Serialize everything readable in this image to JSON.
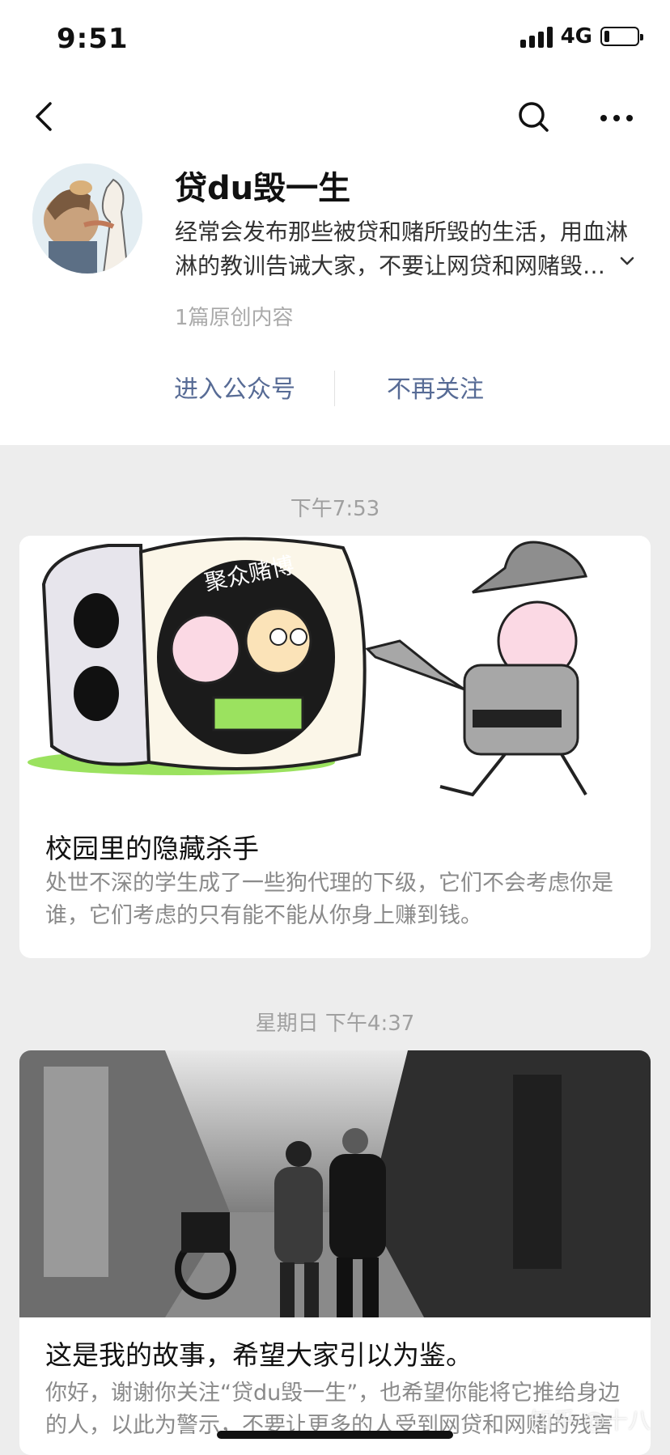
{
  "status_bar": {
    "time": "9:51",
    "network": "4G"
  },
  "nav": {
    "back_icon": "chevron-left-icon",
    "search_icon": "search-icon",
    "more_icon": "more-dots-icon"
  },
  "account": {
    "name": "贷du毁一生",
    "description": "经常会发布那些被贷和赌所毁的生活，用血淋淋的教训告诫大家，不要让网贷和网赌毁…",
    "original_count": "1篇原创内容",
    "enter_label": "进入公众号",
    "unfollow_label": "不再关注"
  },
  "feed": [
    {
      "timestamp": "下午7:53",
      "image_caption": "聚众赌博",
      "title": "校园里的隐藏杀手",
      "summary": "处世不深的学生成了一些狗代理的下级，它们不会考虑你是谁，它们考虑的只有能不能从你身上赚到钱。"
    },
    {
      "timestamp": "星期日 下午4:37",
      "title": "这是我的故事，希望大家引以为鉴。",
      "summary": "你好，谢谢你关注“贷du毁一生”，也希望你能将它推给身边的人，以此为警示，不要让更多的人受到网贷和网赌的残害"
    }
  ],
  "watermark": "知乎 @十八"
}
